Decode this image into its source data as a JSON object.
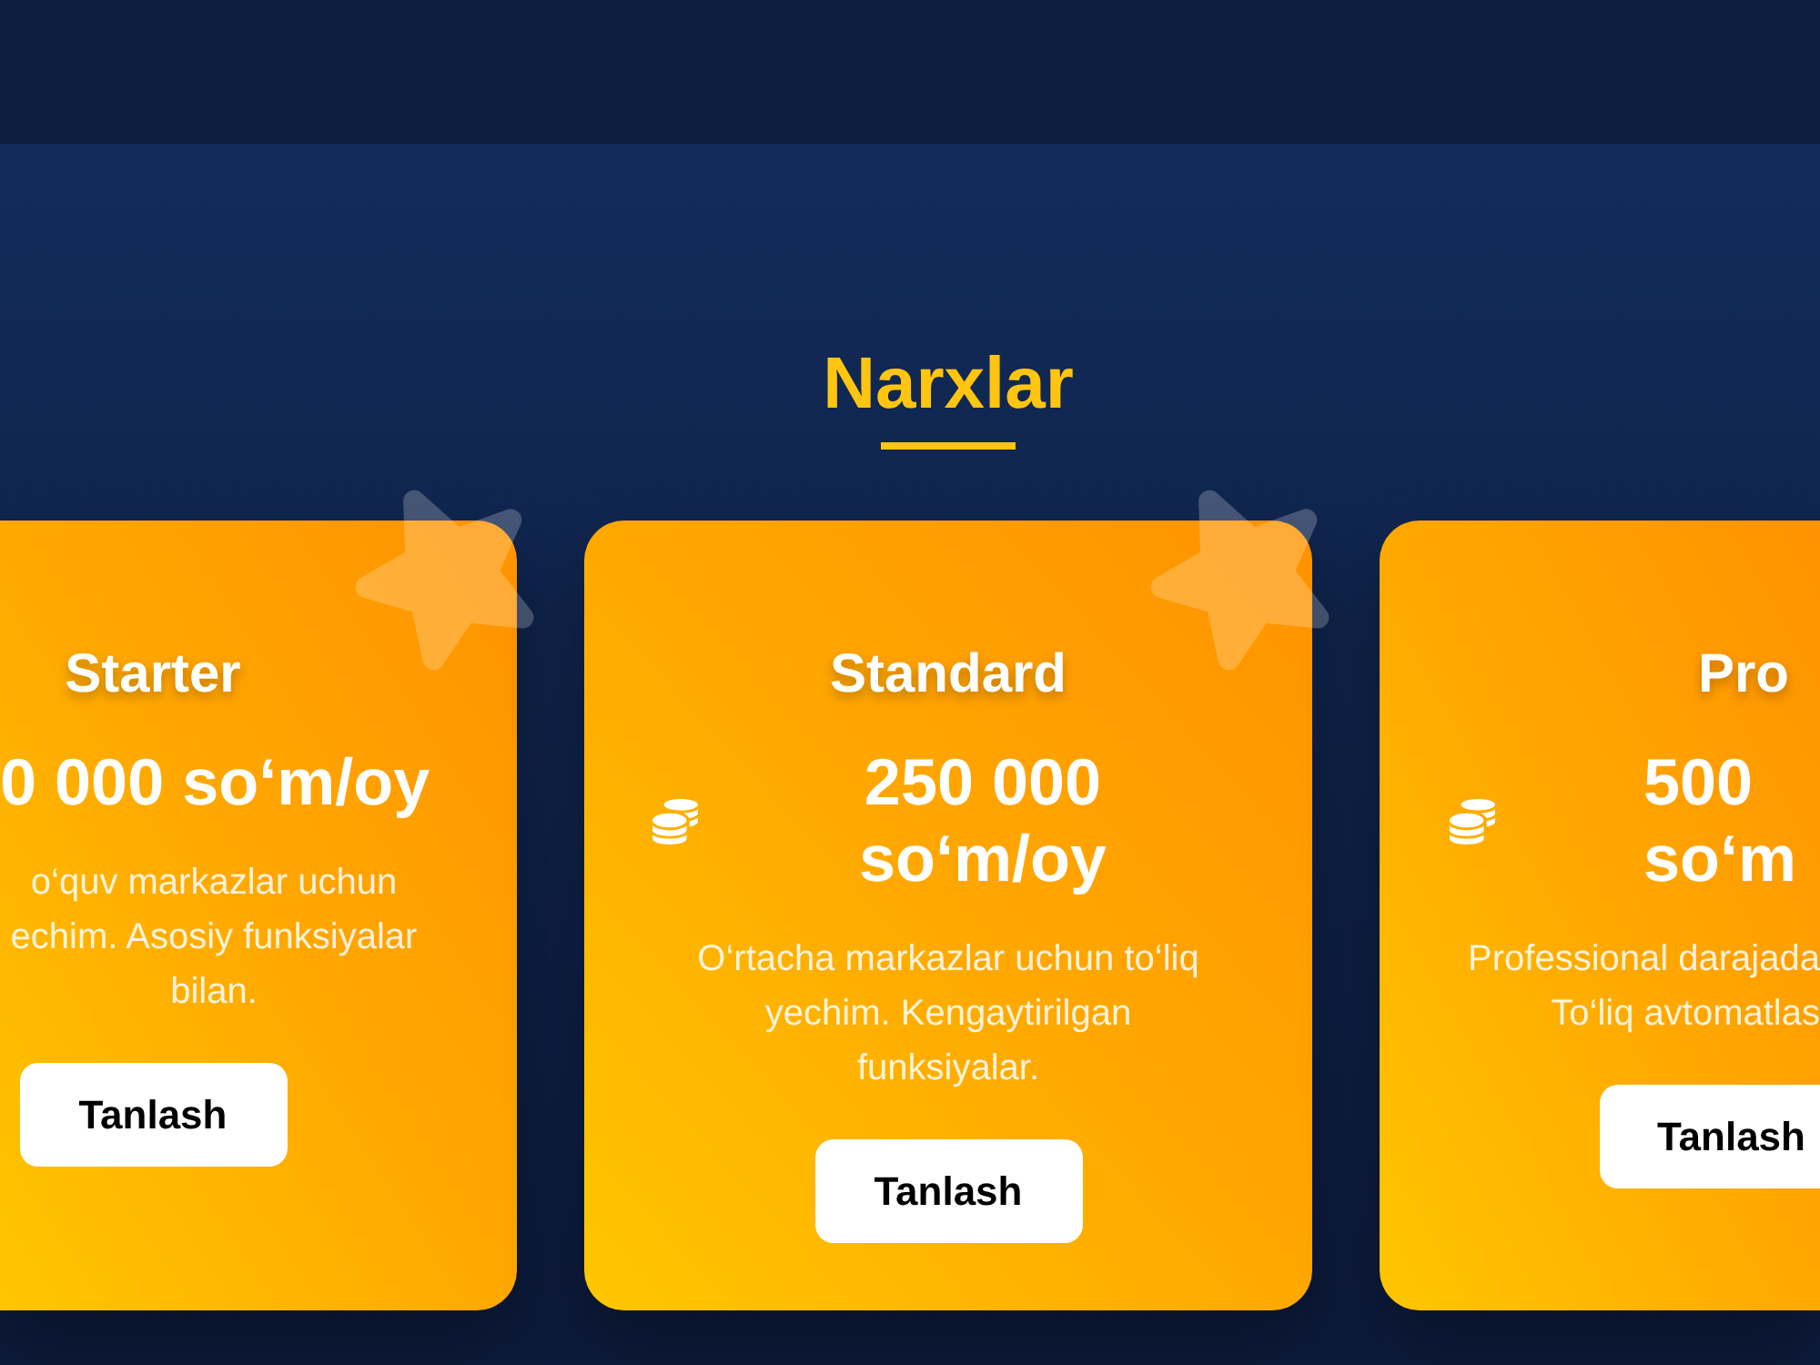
{
  "section": {
    "title": "Narxlar"
  },
  "plans": [
    {
      "name": "Starter",
      "price": "0 000 so‘m/oy",
      "description": "o‘quv markazlar uchun echim. Asosiy funksiyalar bilan.",
      "button_label": "Tanlash"
    },
    {
      "name": "Standard",
      "price": "250 000 so‘m/oy",
      "description": "O‘rtacha markazlar uchun to‘liq yechim. Kengaytirilgan funksiyalar.",
      "button_label": "Tanlash"
    },
    {
      "name": "Pro",
      "price": "500 so‘m",
      "description": "Professional darajada To‘liq avtomatlas",
      "button_label": "Tanlash"
    }
  ]
}
